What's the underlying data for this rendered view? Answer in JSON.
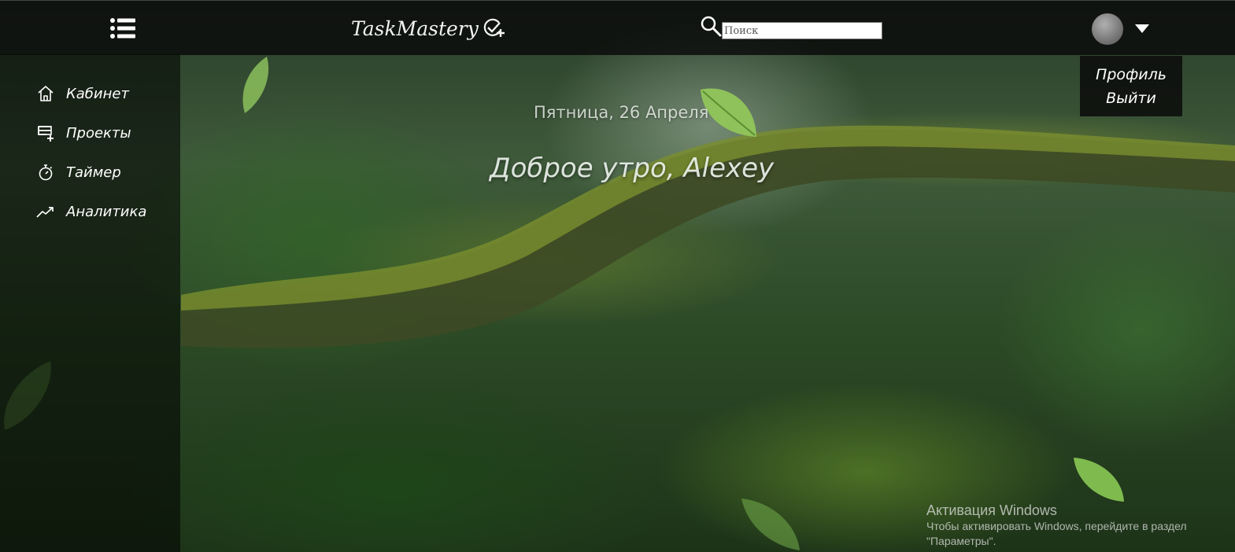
{
  "header": {
    "brand": "TaskMastery",
    "search_placeholder": "Поиск"
  },
  "user_menu": {
    "items": [
      {
        "label": "Профиль"
      },
      {
        "label": "Выйти"
      }
    ]
  },
  "sidebar": {
    "items": [
      {
        "label": "Кабинет",
        "icon": "home-icon"
      },
      {
        "label": "Проекты",
        "icon": "projects-icon"
      },
      {
        "label": "Таймер",
        "icon": "stopwatch-icon"
      },
      {
        "label": "Аналитика",
        "icon": "trend-up-icon"
      }
    ]
  },
  "main": {
    "date": "Пятница, 26 Апреля",
    "greeting": "Доброе утро, Alexey"
  },
  "windows_activation": {
    "title": "Активация Windows",
    "text": "Чтобы активировать Windows, перейдите в раздел \"Параметры\"."
  }
}
